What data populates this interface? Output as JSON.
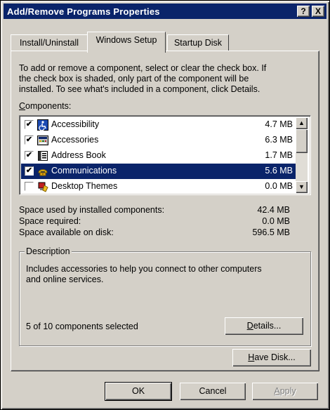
{
  "window": {
    "title": "Add/Remove Programs Properties",
    "help_glyph": "?",
    "close_glyph": "X"
  },
  "tabs": [
    {
      "label": "Install/Uninstall",
      "active": false
    },
    {
      "label": "Windows Setup",
      "active": true
    },
    {
      "label": "Startup Disk",
      "active": false
    }
  ],
  "instructions": [
    "To add or remove a component, select or clear the check box. If",
    "the check box is shaded, only part of the component will be",
    "installed. To see what's included in a component, click Details."
  ],
  "components_label": "Components:",
  "components": [
    {
      "name": "Accessibility",
      "size": "4.7 MB",
      "checked": true,
      "selected": false,
      "icon": "accessibility-icon"
    },
    {
      "name": "Accessories",
      "size": "6.3 MB",
      "checked": true,
      "selected": false,
      "icon": "accessories-icon"
    },
    {
      "name": "Address Book",
      "size": "1.7 MB",
      "checked": true,
      "selected": false,
      "icon": "address-book-icon"
    },
    {
      "name": "Communications",
      "size": "5.6 MB",
      "checked": true,
      "selected": true,
      "icon": "communications-icon"
    },
    {
      "name": "Desktop Themes",
      "size": "0.0 MB",
      "checked": false,
      "selected": false,
      "icon": "desktop-themes-icon"
    }
  ],
  "space": {
    "used_label": "Space used by installed components:",
    "used_value": "42.4 MB",
    "required_label": "Space required:",
    "required_value": "0.0 MB",
    "available_label": "Space available on disk:",
    "available_value": "596.5 MB"
  },
  "description": {
    "legend": "Description",
    "text_line1": "Includes accessories to help you connect to other computers",
    "text_line2": "and online services.",
    "selected_count": "5 of 10 components selected"
  },
  "buttons": {
    "details": "Details...",
    "have_disk": "Have Disk...",
    "ok": "OK",
    "cancel": "Cancel",
    "apply": "Apply"
  },
  "colors": {
    "titlebar": "#0a246a",
    "face": "#d4d0c8",
    "selection": "#0a246a"
  }
}
